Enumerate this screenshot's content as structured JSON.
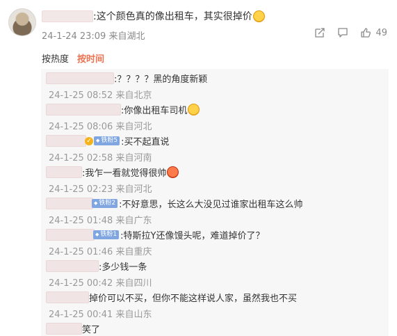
{
  "main_comment": {
    "text": ":这个颜色真的像出租车，其实很掉价",
    "emoji": "laugh-cry-emoji",
    "meta": "24-1-24 23:09 来自湖北",
    "like_count": "49"
  },
  "sort": {
    "by_hot": "按热度",
    "by_time": "按时间"
  },
  "replies": [
    {
      "text": ":？？？？黑的角度新颖",
      "meta": "24-1-25 08:52 来自北京"
    },
    {
      "text": ":你像出租车司机",
      "emoji": "grin-emoji",
      "meta": "24-1-25 08:06 来自河北"
    },
    {
      "badge": "铁粉5",
      "text": ":买不起直说",
      "meta": "24-1-25 02:58 来自河南"
    },
    {
      "text": ":我乍一看就觉得很帅",
      "emoji": "red-emoji",
      "meta": "24-1-25 02:23 来自河北"
    },
    {
      "badge": "铁粉2",
      "text": ":不好意思，长这么大没见过谁家出租车这么帅",
      "meta": "24-1-25 01:48 来自广东"
    },
    {
      "badge": "铁粉1",
      "text": ":特斯拉Y还像馒头呢，难道掉价了？",
      "meta": "24-1-25 01:46 来自重庆"
    },
    {
      "text": ":多少钱一条",
      "meta": "24-1-25 00:42 来自四川"
    },
    {
      "text": "掉价可以不买，但你不能这样说人家，虽然我也不买",
      "meta": "24-1-25 00:41 来自山东"
    },
    {
      "text": "笑了"
    }
  ]
}
